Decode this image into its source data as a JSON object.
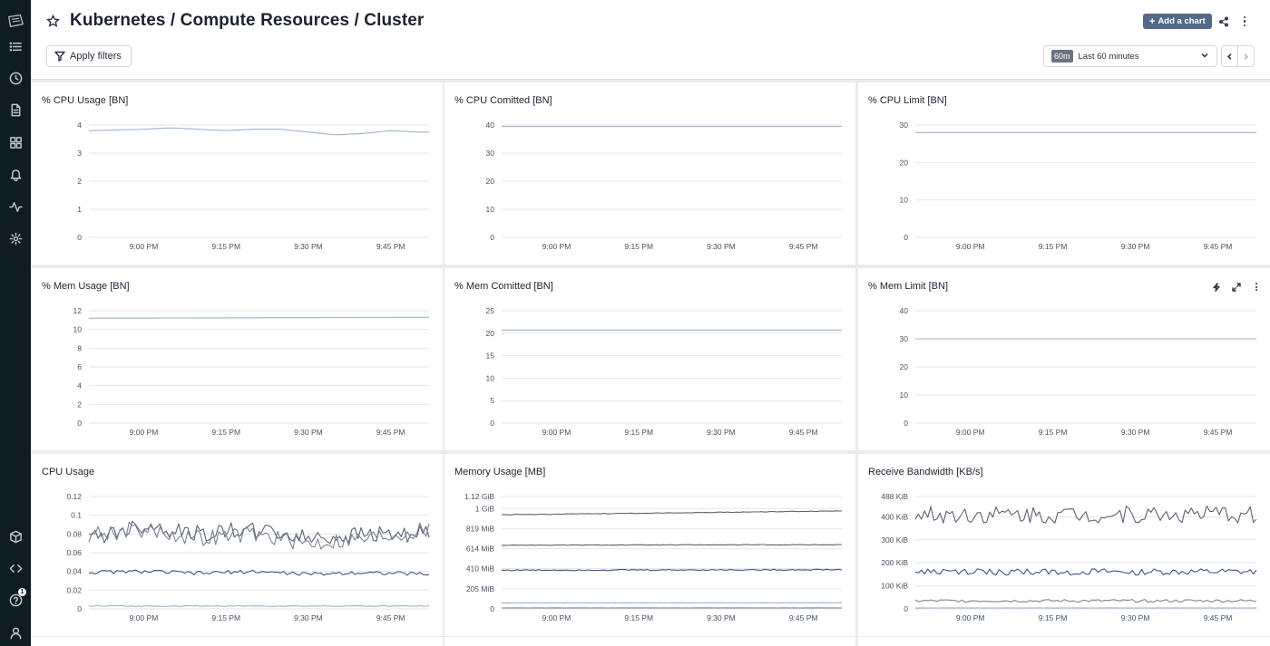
{
  "header": {
    "title": "Kubernetes / Compute Resources / Cluster",
    "add_chart_label": "Add a chart",
    "apply_filters_label": "Apply filters",
    "time_badge": "60m",
    "time_range_label": "Last 60 minutes"
  },
  "sidebar": {
    "icons": [
      "logo-icon",
      "list-icon",
      "clock-icon",
      "document-icon",
      "dashboard-grid-icon",
      "bell-icon",
      "activity-icon",
      "gear-icon",
      "package-icon",
      "code-icon",
      "help-icon",
      "user-icon"
    ],
    "help_badge": "1"
  },
  "colors": {
    "sidebar_bg": "#0f1c24",
    "accent_button": "#546987",
    "series_light": "#9db3d1",
    "series_dark": "#3d5378",
    "series_gray": "#5b6270",
    "grid": "#e6e8ec"
  },
  "panels": [
    {
      "title": "% CPU Usage [BN]",
      "chart_data": {
        "type": "line",
        "x": [
          "8:50 PM",
          "9:00 PM",
          "9:05 PM",
          "9:10 PM",
          "9:15 PM",
          "9:20 PM",
          "9:25 PM",
          "9:30 PM",
          "9:35 PM",
          "9:40 PM",
          "9:45 PM",
          "9:50 PM",
          "9:52 PM"
        ],
        "x_ticks": [
          "9:00 PM",
          "9:15 PM",
          "9:30 PM",
          "9:45 PM"
        ],
        "y_ticks": [
          "0",
          "1",
          "2",
          "3",
          "4"
        ],
        "ylim": [
          0,
          4
        ],
        "series": [
          {
            "color": "#9db3d1",
            "values": [
              3.8,
              3.85,
              3.9,
              3.85,
              3.8,
              3.85,
              3.85,
              3.75,
              3.65,
              3.7,
              3.8,
              3.75,
              3.75
            ]
          }
        ]
      }
    },
    {
      "title": "% CPU Comitted [BN]",
      "chart_data": {
        "type": "line",
        "x": [
          "8:50 PM",
          "9:52 PM"
        ],
        "x_ticks": [
          "9:00 PM",
          "9:15 PM",
          "9:30 PM",
          "9:45 PM"
        ],
        "y_ticks": [
          "0",
          "10",
          "20",
          "30",
          "40"
        ],
        "ylim": [
          0,
          40
        ],
        "series": [
          {
            "color": "#9db3d1",
            "values": [
              39.5,
              39.5
            ]
          }
        ]
      }
    },
    {
      "title": "% CPU Limit [BN]",
      "chart_data": {
        "type": "line",
        "x": [
          "8:50 PM",
          "9:52 PM"
        ],
        "x_ticks": [
          "9:00 PM",
          "9:15 PM",
          "9:30 PM",
          "9:45 PM"
        ],
        "y_ticks": [
          "0",
          "10",
          "20",
          "30"
        ],
        "ylim": [
          0,
          30
        ],
        "series": [
          {
            "color": "#9db3d1",
            "values": [
              28,
              28
            ]
          }
        ]
      }
    },
    {
      "title": "% Mem Usage [BN]",
      "chart_data": {
        "type": "line",
        "x": [
          "8:50 PM",
          "9:52 PM"
        ],
        "x_ticks": [
          "9:00 PM",
          "9:15 PM",
          "9:30 PM",
          "9:45 PM"
        ],
        "y_ticks": [
          "0",
          "2",
          "4",
          "6",
          "8",
          "10",
          "12"
        ],
        "ylim": [
          0,
          12
        ],
        "series": [
          {
            "color": "#9db3d1",
            "values": [
              11.2,
              11.3
            ]
          }
        ]
      }
    },
    {
      "title": "% Mem Comitted [BN]",
      "chart_data": {
        "type": "line",
        "x": [
          "8:50 PM",
          "9:52 PM"
        ],
        "x_ticks": [
          "9:00 PM",
          "9:15 PM",
          "9:30 PM",
          "9:45 PM"
        ],
        "y_ticks": [
          "0",
          "5",
          "10",
          "15",
          "20",
          "25"
        ],
        "ylim": [
          0,
          25
        ],
        "series": [
          {
            "color": "#9db3d1",
            "values": [
              20.7,
              20.7
            ]
          }
        ]
      }
    },
    {
      "title": "% Mem Limit [BN]",
      "show_tools": true,
      "chart_data": {
        "type": "line",
        "x": [
          "8:50 PM",
          "9:52 PM"
        ],
        "x_ticks": [
          "9:00 PM",
          "9:15 PM",
          "9:30 PM",
          "9:45 PM"
        ],
        "y_ticks": [
          "0",
          "10",
          "20",
          "30",
          "40"
        ],
        "ylim": [
          0,
          40
        ],
        "series": [
          {
            "color": "#9db3d1",
            "values": [
              30,
              30
            ]
          }
        ]
      }
    },
    {
      "title": "CPU Usage",
      "chart_data": {
        "type": "line",
        "x": [
          "8:50 PM",
          "9:00 PM",
          "9:10 PM",
          "9:20 PM",
          "9:30 PM",
          "9:40 PM",
          "9:52 PM"
        ],
        "x_ticks": [
          "9:00 PM",
          "9:15 PM",
          "9:30 PM",
          "9:45 PM"
        ],
        "y_ticks": [
          "0",
          "0.02",
          "0.04",
          "0.06",
          "0.08",
          "0.1",
          "0.12"
        ],
        "ylim": [
          0,
          0.12
        ],
        "series": [
          {
            "color": "#5b6270",
            "values": [
              0.075,
              0.09,
              0.08,
              0.085,
              0.075,
              0.08,
              0.08
            ],
            "noise": 0.009
          },
          {
            "color": "#7b8290",
            "values": [
              0.08,
              0.085,
              0.075,
              0.08,
              0.07,
              0.075,
              0.085
            ],
            "noise": 0.009
          },
          {
            "color": "#3d5378",
            "values": [
              0.039,
              0.04,
              0.038,
              0.04,
              0.037,
              0.039,
              0.037
            ],
            "noise": 0.002
          },
          {
            "color": "#9db3d1",
            "values": [
              0.003,
              0.003,
              0.003,
              0.003,
              0.003,
              0.003,
              0.003
            ],
            "noise": 0.0005
          }
        ]
      }
    },
    {
      "title": "Memory Usage [MB]",
      "chart_data": {
        "type": "line",
        "x": [
          "8:50 PM",
          "9:52 PM"
        ],
        "x_ticks": [
          "9:00 PM",
          "9:15 PM",
          "9:30 PM",
          "9:45 PM"
        ],
        "y_ticks": [
          "0",
          "205 MiB",
          "410 MiB",
          "614 MiB",
          "819 MiB",
          "1 GiB",
          "1.12 GiB"
        ],
        "y_tick_values": [
          0,
          205,
          410,
          614,
          819,
          1024,
          1147
        ],
        "ylim": [
          0,
          1147
        ],
        "series": [
          {
            "color": "#5b6270",
            "values": [
              960,
              1000
            ],
            "noise": 3
          },
          {
            "color": "#5b6270",
            "values": [
              650,
              655
            ],
            "noise": 3
          },
          {
            "color": "#3d5378",
            "values": [
              395,
              400
            ],
            "noise": 6
          },
          {
            "color": "#9db3d1",
            "values": [
              60,
              62
            ],
            "noise": 1
          },
          {
            "color": "#7b8290",
            "values": [
              10,
              10
            ],
            "noise": 0.5
          }
        ]
      }
    },
    {
      "title": "Receive Bandwidth [KB/s]",
      "chart_data": {
        "type": "line",
        "x": [
          "8:50 PM",
          "9:52 PM"
        ],
        "x_ticks": [
          "9:00 PM",
          "9:15 PM",
          "9:30 PM",
          "9:45 PM"
        ],
        "y_ticks": [
          "0",
          "100 KiB",
          "200 KiB",
          "300 KiB",
          "400 KiB",
          "488 KiB"
        ],
        "y_tick_values": [
          0,
          100,
          200,
          300,
          400,
          488
        ],
        "ylim": [
          0,
          488
        ],
        "series": [
          {
            "color": "#5b6270",
            "values": [
              410,
              410
            ],
            "noise": 38
          },
          {
            "color": "#3d5378",
            "values": [
              160,
              160
            ],
            "noise": 14
          },
          {
            "color": "#7b8290",
            "values": [
              35,
              35
            ],
            "noise": 6
          },
          {
            "color": "#9db3d1",
            "values": [
              4,
              4
            ],
            "noise": 0.5
          }
        ]
      }
    }
  ]
}
